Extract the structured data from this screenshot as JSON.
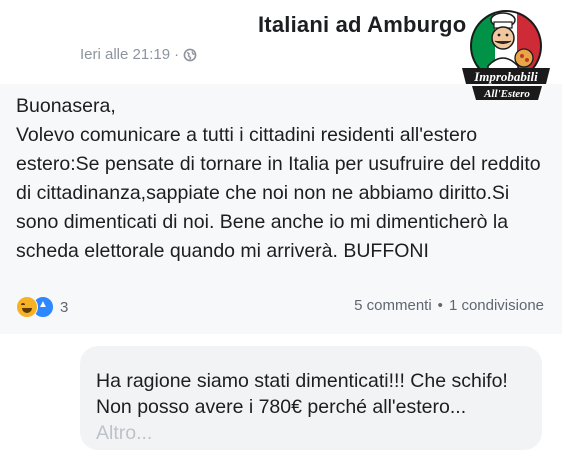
{
  "header": {
    "group_name": "Italiani ad Amburgo",
    "timestamp": "Ieri alle 21:19",
    "separator": "·"
  },
  "post": {
    "body": "Buonasera,\nVolevo comunicare a tutti i cittadini residenti all'estero estero:Se pensate di tornare in Italia per usufruire del reddito di cittadinanza,sappiate che noi non ne abbiamo diritto.Si sono dimenticati di noi. Bene anche io mi dimenticherò la scheda elettorale quando mi arriverà. BUFFONI",
    "reactions_count": "3",
    "comments": "5 commenti",
    "stats_separator": "•",
    "shares": "1 condivisione"
  },
  "comment": {
    "text": "Ha ragione siamo stati dimenticati!!! Che schifo! Non posso avere i 780€ perché all'estero...",
    "more": "Altro..."
  },
  "logo": {
    "line1": "Improbabili",
    "line2": "All'Estero"
  },
  "icons": [
    "globe-icon",
    "haha-reaction-icon",
    "like-reaction-icon"
  ],
  "colors": {
    "flag_green": "#009246",
    "flag_white": "#ffffff",
    "flag_red": "#ce2b37",
    "like_blue": "#2d88ff",
    "haha_yellow": "#f7b125"
  }
}
